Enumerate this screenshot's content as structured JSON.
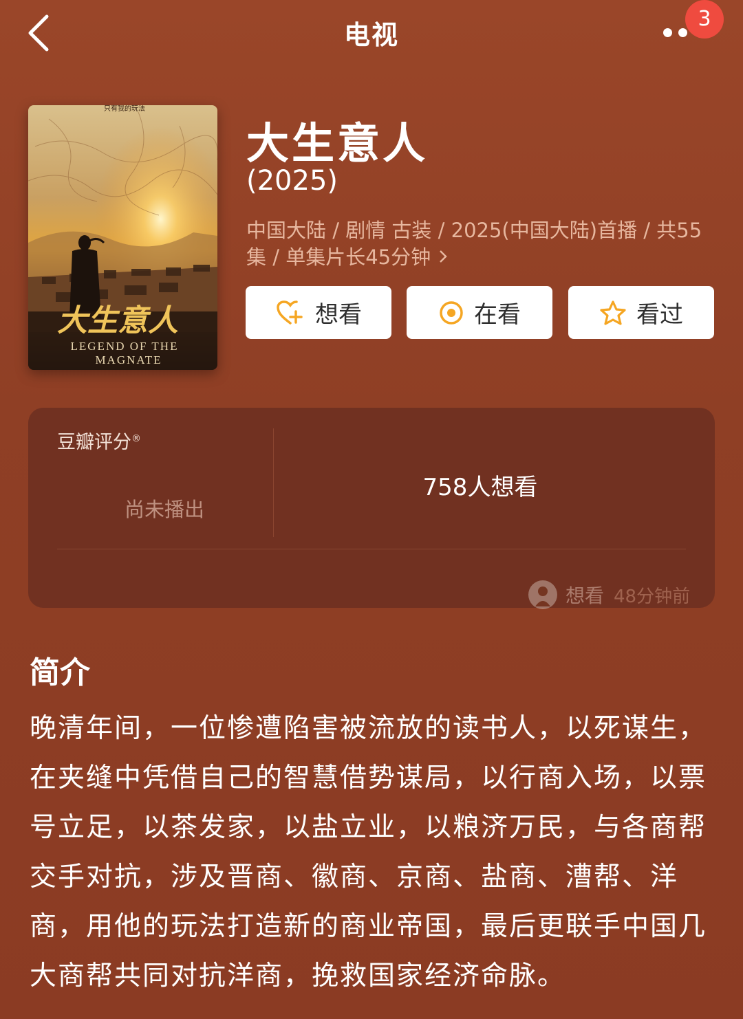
{
  "header": {
    "title": "电视",
    "notification_count": "3"
  },
  "show": {
    "title": "大生意人",
    "year": "(2025)",
    "meta_line": "中国大陆 / 剧情 古装 / 2025(中国大陆)首播 / 共55集 / 单集片长45分钟",
    "poster": {
      "top_text": "只有我的玩法",
      "calligraphy": "大生意人",
      "english_line1": "LEGEND OF THE",
      "english_line2": "MAGNATE"
    }
  },
  "actions": {
    "want": "想看",
    "watching": "在看",
    "watched": "看过"
  },
  "rating": {
    "label": "豆瓣评分",
    "mark": "®",
    "status": "尚未播出",
    "want_count": "758人想看",
    "activity_label": "想看",
    "activity_time": "48分钟前"
  },
  "intro": {
    "heading": "简介",
    "text": "晚清年间，一位惨遭陷害被流放的读书人，以死谋生，在夹缝中凭借自己的智慧借势谋局，以行商入场，以票号立足，以茶发家，以盐立业，以粮济万民，与各商帮交手对抗，涉及晋商、徽商、京商、盐商、漕帮、洋商，用他的玩法打造新的商业帝国，最后更联手中国几大商帮共同对抗洋商，挽救国家经济命脉。"
  },
  "colors": {
    "background": "#8e3e24",
    "panel": "#713121",
    "badge": "#ef4b3f",
    "accent_icon": "#f5a623"
  },
  "icons": [
    "back-arrow-icon",
    "more-dots-icon",
    "heart-plus-icon",
    "target-icon",
    "star-icon",
    "chevron-right-icon"
  ]
}
